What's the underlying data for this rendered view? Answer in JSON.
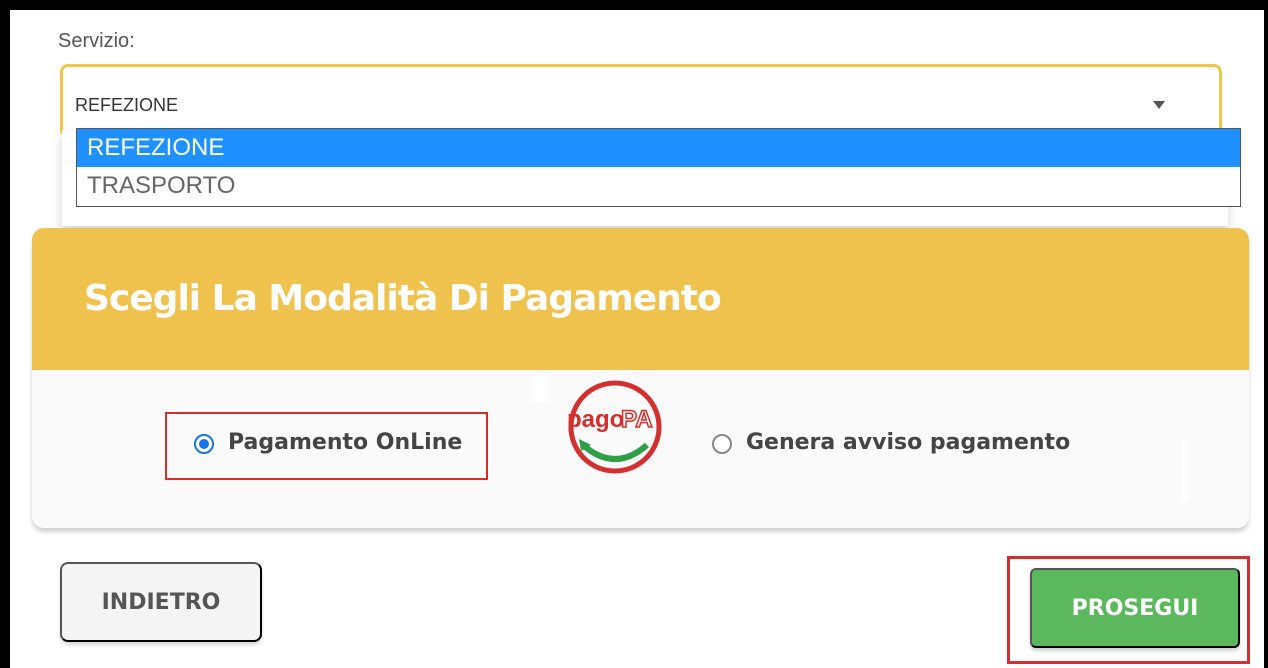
{
  "service": {
    "label": "Servizio:",
    "selected_value": "REFEZIONE",
    "options": [
      "REFEZIONE",
      "TRASPORTO"
    ],
    "accent_color": "#f0c648",
    "highlight_color": "#1e90ff"
  },
  "payment": {
    "title": "Scegli La Modalità Di Pagamento",
    "header_color": "#eec24d",
    "options": [
      {
        "label": "Pagamento OnLine",
        "checked": true
      },
      {
        "label": "Genera avviso pagamento",
        "checked": false
      }
    ],
    "logo": {
      "icon": "pagopa-logo-icon",
      "text_left": "pago",
      "text_right": "PA",
      "color": "#d32f2f"
    }
  },
  "actions": {
    "back_label": "INDIETRO",
    "next_label": "PROSEGUI",
    "next_color": "#5cb85c"
  }
}
